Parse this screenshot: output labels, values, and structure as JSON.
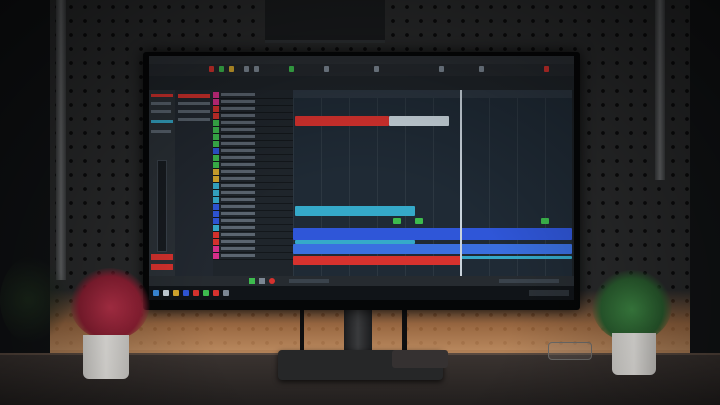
{
  "scene": {
    "description_type": "photo",
    "colors": {
      "wall": "#2a2b2c",
      "desk_glow": "#f09650",
      "screen_bg": "#1c2126",
      "clip_red": "#d6322e",
      "clip_cyan": "#35a9c9",
      "clip_blue": "#2f56d8",
      "clip_light": "#c8d4dc",
      "plant_red": "#a4283a",
      "plant_green": "#2f6b34"
    },
    "icons": [
      "window-icon",
      "play-icon",
      "record-icon",
      "stop-icon"
    ]
  }
}
